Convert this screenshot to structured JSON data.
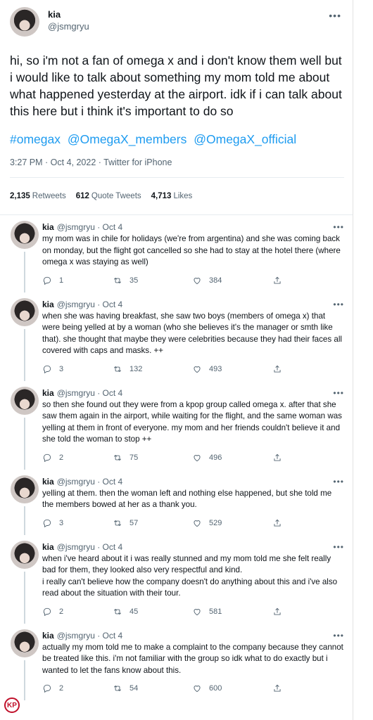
{
  "main_tweet": {
    "name": "kia",
    "handle": "@jsmgryu",
    "more_icon": "ellipsis-icon",
    "text": "hi, so i'm not a fan of omega x and i don't know them well but i would like to talk about something my mom told me about what happened yesterday at the airport. idk if i can talk about this here but i think it's important to do so",
    "hashtags": [
      "#omegax",
      "@OmegaX_members",
      "@OmegaX_official"
    ],
    "timestamp": "3:27 PM · Oct 4, 2022 · Twitter for iPhone",
    "stats": {
      "retweets_count": "2,135",
      "retweets_label": "Retweets",
      "quotes_count": "612",
      "quotes_label": "Quote Tweets",
      "likes_count": "4,713",
      "likes_label": "Likes"
    }
  },
  "replies": [
    {
      "name": "kia",
      "handle": "@jsmgryu",
      "date": "· Oct 4",
      "text": "my mom was in chile for holidays (we're from argentina) and she was coming back on monday, but the flight got cancelled so she had to stay at the hotel there (where omega x was staying as well)",
      "replies": "1",
      "retweets": "35",
      "likes": "384"
    },
    {
      "name": "kia",
      "handle": "@jsmgryu",
      "date": "· Oct 4",
      "text": "when she was having breakfast, she saw two boys (members of omega x) that were being yelled at by a woman (who she believes it's the manager or smth like that). she thought that maybe they were celebrities because they had their faces all covered with caps and masks. ++",
      "replies": "3",
      "retweets": "132",
      "likes": "493"
    },
    {
      "name": "kia",
      "handle": "@jsmgryu",
      "date": "· Oct 4",
      "text": "so then she found out they were from a kpop group called omega x. after that she saw them again in the airport, while waiting for the flight, and the same woman was yelling at them in front of everyone. my mom and her friends couldn't believe it and she told the woman to stop ++",
      "replies": "2",
      "retweets": "75",
      "likes": "496"
    },
    {
      "name": "kia",
      "handle": "@jsmgryu",
      "date": "· Oct 4",
      "text": "yelling at them. then the woman left and nothing else happened, but she told me the members bowed at her as a thank you.",
      "replies": "3",
      "retweets": "57",
      "likes": "529"
    },
    {
      "name": "kia",
      "handle": "@jsmgryu",
      "date": "· Oct 4",
      "text": "when i've heard about it i was really stunned and my mom told me she felt really bad for them, they looked also very respectful and kind.\ni really can't believe how the company doesn't do anything about this and i've also read about the situation with their tour.",
      "replies": "2",
      "retweets": "45",
      "likes": "581"
    },
    {
      "name": "kia",
      "handle": "@jsmgryu",
      "date": "· Oct 4",
      "text": "actually my mom told me to make a complaint to the company because they cannot be treated like this. i'm not familiar with the group so idk what to do exactly but i wanted to let the fans know about this.",
      "replies": "2",
      "retweets": "54",
      "likes": "600"
    }
  ],
  "watermark": "KP",
  "colors": {
    "link": "#1d9bf0",
    "secondary": "#536471",
    "text": "#0f1419"
  }
}
